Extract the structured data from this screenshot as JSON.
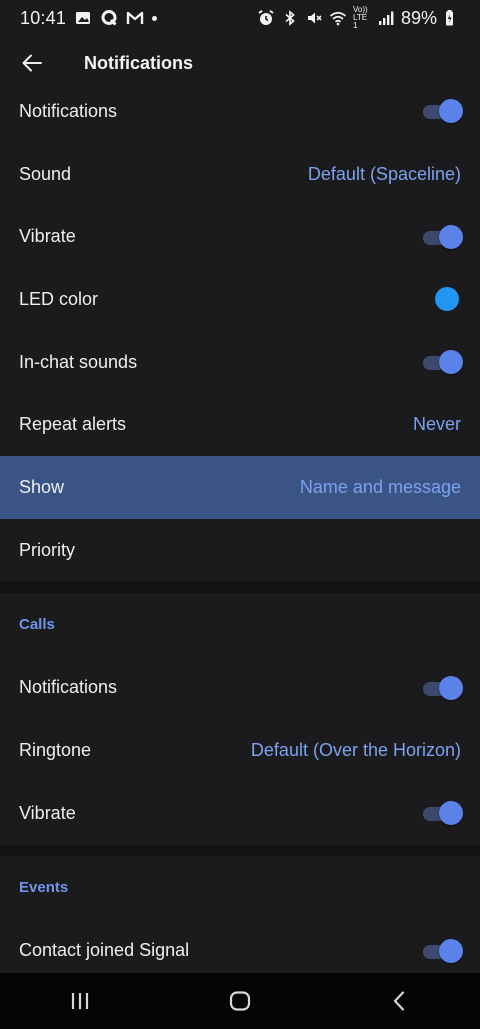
{
  "status_bar": {
    "time": "10:41",
    "battery": "89%",
    "left_icons": [
      "gallery-icon",
      "q-app-icon",
      "gmail-icon",
      "dot-icon"
    ],
    "right_icons": [
      "alarm-icon",
      "bluetooth-icon",
      "mute-icon",
      "wifi-icon",
      "volte-icon",
      "signal-icon",
      "battery-charging-icon"
    ],
    "volte_label": "Vo)) LTE1"
  },
  "app_bar": {
    "title": "Notifications"
  },
  "messages": {
    "notifications_label": "Notifications",
    "notifications_on": true,
    "sound_label": "Sound",
    "sound_value": "Default (Spaceline)",
    "vibrate_label": "Vibrate",
    "vibrate_on": true,
    "led_label": "LED color",
    "led_color": "#2196f3",
    "inchat_label": "In-chat sounds",
    "inchat_on": true,
    "repeat_label": "Repeat alerts",
    "repeat_value": "Never",
    "show_label": "Show",
    "show_value": "Name and message",
    "priority_label": "Priority"
  },
  "calls": {
    "header": "Calls",
    "notifications_label": "Notifications",
    "notifications_on": true,
    "ringtone_label": "Ringtone",
    "ringtone_value": "Default (Over the Horizon)",
    "vibrate_label": "Vibrate",
    "vibrate_on": true
  },
  "events": {
    "header": "Events",
    "contact_joined_label": "Contact joined Signal",
    "contact_joined_on": true
  },
  "colors": {
    "accent": "#6f95ea",
    "toggle_knob": "#5b82e8",
    "highlight_row": "#3b5486",
    "background": "#1b1b1d"
  }
}
